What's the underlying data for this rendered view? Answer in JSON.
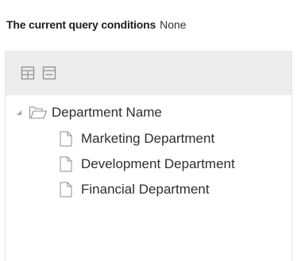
{
  "query": {
    "label": "The current query conditions",
    "value": "None"
  },
  "toolbar": {
    "expand_icon": "expand-all-icon",
    "collapse_icon": "collapse-all-icon"
  },
  "tree": {
    "root_label": "Department Name",
    "root_expanded": true,
    "items": [
      {
        "label": "Marketing Department"
      },
      {
        "label": "Development Department"
      },
      {
        "label": "Financial Department"
      }
    ]
  },
  "colors": {
    "toolbar_bg": "#ededed",
    "icon_stroke": "#9a9a9a",
    "text": "#2e2e2e"
  }
}
